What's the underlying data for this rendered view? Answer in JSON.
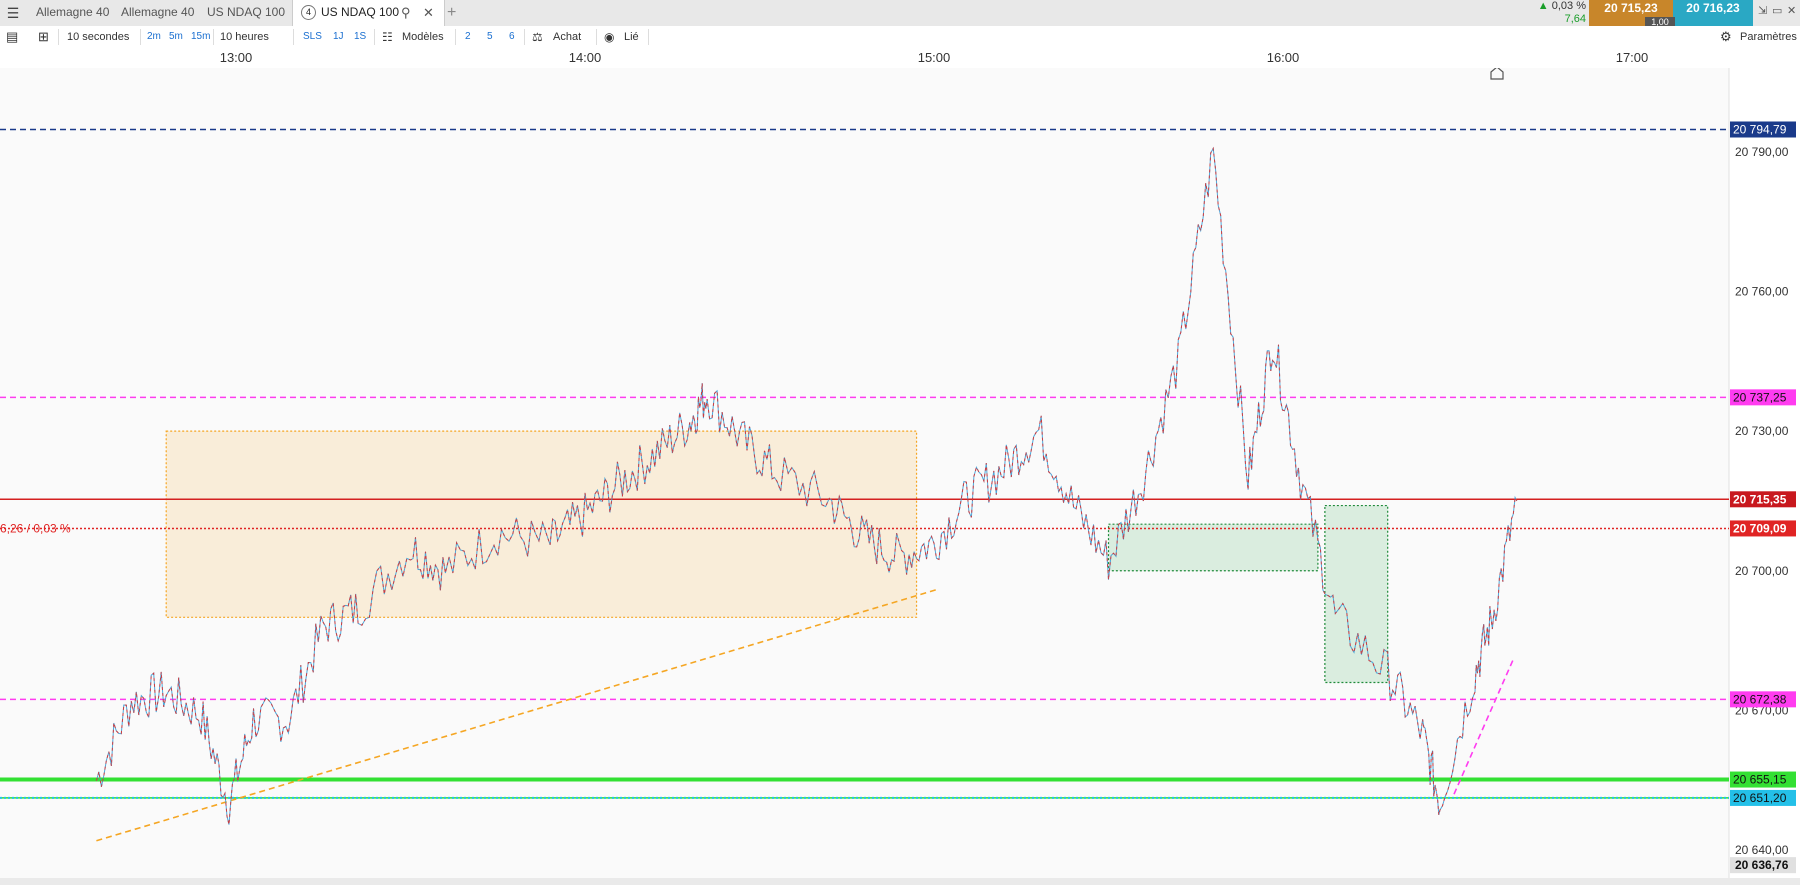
{
  "tabs": [
    {
      "label": "Allemagne 40"
    },
    {
      "label": "Allemagne 40"
    },
    {
      "label": "US NDAQ 100"
    },
    {
      "label": "US NDAQ 100",
      "number": "4"
    }
  ],
  "quote": {
    "change_pct": "0,03 %",
    "change_pts": "7,64",
    "bid": "20 715,23",
    "ask": "20 716,23",
    "spread": "1,00"
  },
  "toolbar": {
    "interval": "10 secondes",
    "btn_2m": "2m",
    "btn_5m": "5m",
    "btn_15m": "15m",
    "period": "10 heures",
    "btn_sls": "SLS",
    "btn_1j": "1J",
    "btn_1s": "1S",
    "models": "Modèles",
    "n2": "2",
    "n5": "5",
    "n6": "6",
    "buy": "Achat",
    "linked": "Lié",
    "settings": "Paramètres"
  },
  "time_axis": [
    "13:00",
    "14:00",
    "15:00",
    "16:00",
    "17:00"
  ],
  "chart_data": {
    "type": "line",
    "instrument": "US NDAQ 100",
    "ylim": [
      20634,
      20808
    ],
    "y_ticks": [
      "20 790,00",
      "20 760,00",
      "20 730,00",
      "20 700,00",
      "20 670,00",
      "20 640,00"
    ],
    "y_tick_values": [
      20790,
      20760,
      20730,
      20700,
      20670,
      20640
    ],
    "x_ticks": [
      "13:00",
      "14:00",
      "15:00",
      "16:00",
      "17:00"
    ],
    "price_path": [
      [
        12.6,
        20655
      ],
      [
        12.7,
        20672
      ],
      [
        12.8,
        20674
      ],
      [
        12.9,
        20669
      ],
      [
        12.98,
        20650
      ],
      [
        13.05,
        20668
      ],
      [
        13.15,
        20668
      ],
      [
        13.25,
        20688
      ],
      [
        13.35,
        20692
      ],
      [
        13.5,
        20705
      ],
      [
        13.6,
        20700
      ],
      [
        13.75,
        20708
      ],
      [
        13.9,
        20706
      ],
      [
        14.0,
        20712
      ],
      [
        14.1,
        20719
      ],
      [
        14.2,
        20725
      ],
      [
        14.3,
        20732
      ],
      [
        14.35,
        20738
      ],
      [
        14.45,
        20728
      ],
      [
        14.55,
        20721
      ],
      [
        14.7,
        20715
      ],
      [
        14.8,
        20707
      ],
      [
        14.9,
        20703
      ],
      [
        15.0,
        20706
      ],
      [
        15.1,
        20716
      ],
      [
        15.2,
        20722
      ],
      [
        15.3,
        20730
      ],
      [
        15.4,
        20714
      ],
      [
        15.5,
        20702
      ],
      [
        15.6,
        20720
      ],
      [
        15.7,
        20745
      ],
      [
        15.8,
        20790
      ],
      [
        15.9,
        20720
      ],
      [
        15.97,
        20750
      ],
      [
        16.05,
        20720
      ],
      [
        16.15,
        20690
      ],
      [
        16.3,
        20678
      ],
      [
        16.4,
        20665
      ],
      [
        16.45,
        20650
      ],
      [
        16.55,
        20678
      ],
      [
        16.6,
        20690
      ],
      [
        16.67,
        20715
      ]
    ],
    "levels": [
      {
        "label": "20 794,79",
        "value": 20794.79,
        "color": "#1a3a8a",
        "style": "dashed"
      },
      {
        "label": "20 737,25",
        "value": 20737.25,
        "color": "#ff3cf0",
        "style": "dashed"
      },
      {
        "label": "20 715,35",
        "value": 20715.35,
        "color": "#d42020",
        "style": "solid"
      },
      {
        "label": "20 709,09",
        "value": 20709.09,
        "color": "#e02424",
        "style": "dotted"
      },
      {
        "label": "20 672,38",
        "value": 20672.38,
        "color": "#ff3cf0",
        "style": "dashed"
      },
      {
        "label": "20 655,15",
        "value": 20655.15,
        "color": "#33e033",
        "style": "solid"
      },
      {
        "label": "20 651,20",
        "value": 20651.2,
        "color": "#24c0e8",
        "style": "dotted"
      }
    ],
    "last_price_label": "20 636,76",
    "left_annotation": "6,26 / 0,03 %",
    "zones": [
      {
        "name": "range-box",
        "x": [
          12.8,
          14.95
        ],
        "y": [
          20690,
          20730
        ],
        "color": "#f5a623"
      },
      {
        "name": "green-zone-1",
        "x": [
          15.5,
          16.1
        ],
        "y": [
          20700,
          20710
        ],
        "color": "#2aa84a"
      },
      {
        "name": "green-zone-2",
        "x": [
          16.12,
          16.3
        ],
        "y": [
          20676,
          20714
        ],
        "color": "#2aa84a"
      }
    ],
    "trendlines": [
      {
        "name": "orange-trendline",
        "from": [
          12.6,
          20642
        ],
        "to": [
          15.01,
          20696
        ],
        "color": "#f5a623"
      },
      {
        "name": "magenta-trendline",
        "from": [
          16.49,
          20652
        ],
        "to": [
          16.66,
          20681
        ],
        "color": "#ff3cf0"
      }
    ]
  }
}
